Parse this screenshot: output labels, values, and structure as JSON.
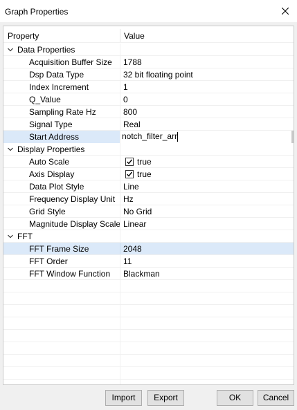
{
  "window": {
    "title": "Graph Properties"
  },
  "grid": {
    "header": {
      "property": "Property",
      "value": "Value"
    },
    "categories": [
      {
        "label": "Data Properties"
      },
      {
        "label": "Display Properties"
      },
      {
        "label": "FFT"
      }
    ],
    "data_properties": [
      {
        "name": "Acquisition Buffer Size",
        "value": "1788"
      },
      {
        "name": "Dsp Data Type",
        "value": "32 bit floating point"
      },
      {
        "name": "Index Increment",
        "value": "1"
      },
      {
        "name": "Q_Value",
        "value": "0"
      },
      {
        "name": "Sampling Rate Hz",
        "value": "800"
      },
      {
        "name": "Signal Type",
        "value": "Real"
      },
      {
        "name": "Start Address",
        "value": "notch_filter_arr"
      }
    ],
    "display_properties": [
      {
        "name": "Auto Scale",
        "value": "true",
        "checked": true
      },
      {
        "name": "Axis Display",
        "value": "true",
        "checked": true
      },
      {
        "name": "Data Plot Style",
        "value": "Line"
      },
      {
        "name": "Frequency Display Unit",
        "value": "Hz"
      },
      {
        "name": "Grid Style",
        "value": "No Grid"
      },
      {
        "name": "Magnitude Display Scale",
        "value": "Linear"
      }
    ],
    "fft": [
      {
        "name": "FFT Frame Size",
        "value": "2048"
      },
      {
        "name": "FFT Order",
        "value": "11"
      },
      {
        "name": "FFT Window Function",
        "value": "Blackman"
      }
    ]
  },
  "buttons": {
    "import": "Import",
    "export": "Export",
    "ok": "OK",
    "cancel": "Cancel"
  },
  "colors": {
    "selection": "#dbe9f9",
    "header_bg": "#ffffff",
    "dialog_bg": "#f0f0f0"
  }
}
